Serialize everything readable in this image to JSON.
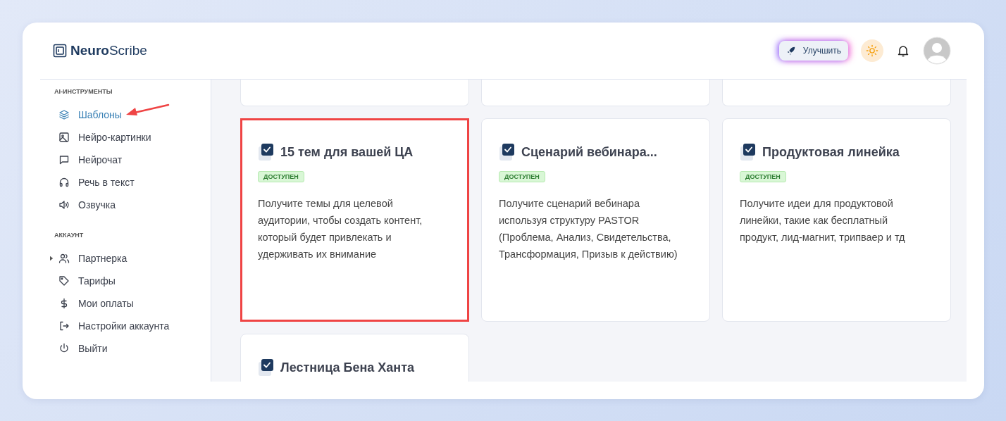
{
  "logo": {
    "bold": "Neuro",
    "light": "Scribe"
  },
  "header": {
    "upgrade_button": "Улучшить"
  },
  "sidebar": {
    "sections": [
      {
        "title": "AI-ИНСТРУМЕНТЫ",
        "items": [
          {
            "label": "Шаблоны",
            "selected": true,
            "pointer": true
          },
          {
            "label": "Нейро-картинки",
            "selected": false,
            "pointer": false
          },
          {
            "label": "Нейрочат",
            "selected": false,
            "pointer": false
          },
          {
            "label": "Речь в текст",
            "selected": false,
            "pointer": false
          },
          {
            "label": "Озвучка",
            "selected": false,
            "pointer": false
          }
        ]
      },
      {
        "title": "АККАУНТ",
        "items": [
          {
            "label": "Партнерка",
            "selected": false,
            "pointer": false,
            "expandable": true
          },
          {
            "label": "Тарифы",
            "selected": false,
            "pointer": false
          },
          {
            "label": "Мои оплаты",
            "selected": false,
            "pointer": false
          },
          {
            "label": "Настройки аккаунта",
            "selected": false,
            "pointer": false
          },
          {
            "label": "Выйти",
            "selected": false,
            "pointer": false
          }
        ]
      }
    ]
  },
  "cards": [
    {
      "title": "15 тем для вашей ЦА",
      "badge": "ДОСТУПЕН",
      "description": "Получите темы для целевой аудитории, чтобы создать контент, который будет привлекать и удерживать их внимание",
      "highlighted": true
    },
    {
      "title": "Сценарий вебинара...",
      "badge": "ДОСТУПЕН",
      "description": "Получите сценарий вебинара используя структуру PASTOR (Проблема, Анализ, Свидетельства, Трансформация, Призыв к действию)",
      "highlighted": false
    },
    {
      "title": "Продуктовая линейка",
      "badge": "ДОСТУПЕН",
      "description": "Получите идеи для продуктовой линейки, такие как бесплатный продукт, лид-магнит, трипваер и тд",
      "highlighted": false
    },
    {
      "title": "Лестница Бена Ханта",
      "highlighted": false
    }
  ]
}
